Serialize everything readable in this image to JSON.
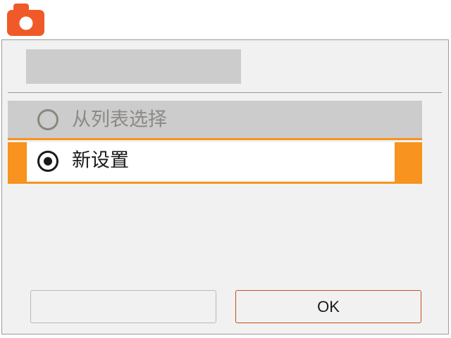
{
  "app": {
    "icon": "camera-icon",
    "accent_color": "#f05a28"
  },
  "dialog": {
    "title": "",
    "options": [
      {
        "label": "从列表选择",
        "selected": false,
        "enabled": false
      },
      {
        "label": "新设置",
        "selected": true,
        "enabled": true
      }
    ],
    "selection_color": "#f7931e",
    "buttons": {
      "cancel_label": "",
      "ok_label": "OK"
    }
  }
}
